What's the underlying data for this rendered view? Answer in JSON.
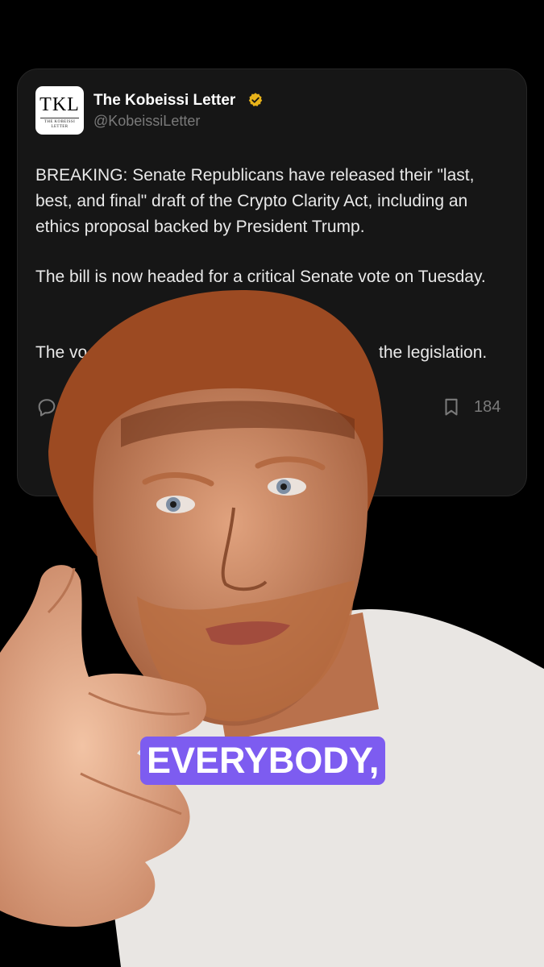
{
  "post": {
    "avatar_text": "TKL",
    "avatar_subtext": "THE KOBEISSI LETTER",
    "author_name": "The Kobeissi Letter",
    "verified_badge_color": "#e8b31a",
    "handle": "@KobeissiLetter",
    "paragraphs": [
      "BREAKING: Senate Republicans have released their \"last, best, and final\" draft of the Crypto Clarity Act, including an ethics proposal backed by President Trump.",
      "The bill is now headed for a critical Senate vote on Tuesday.",
      "The vo",
      "the legislation."
    ],
    "actions": {
      "reply_icon": "reply-icon",
      "bookmark_icon": "bookmark-icon",
      "bookmark_count": "184"
    }
  },
  "caption": {
    "text": "EVERYBODY,",
    "background": "#7d5cf0"
  }
}
